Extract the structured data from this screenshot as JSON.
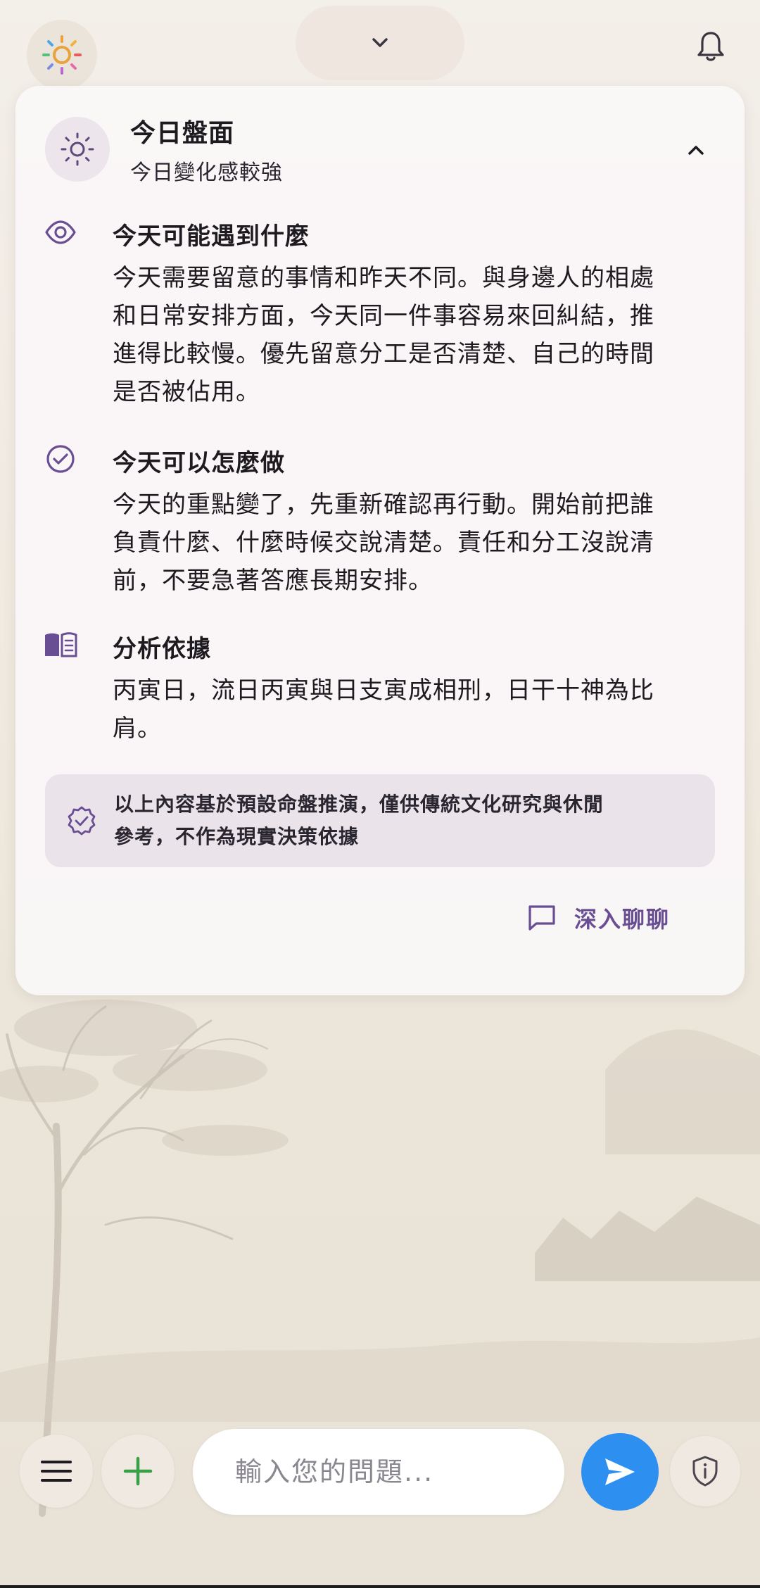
{
  "colors": {
    "accent": "#6a4e94",
    "send_button": "#2d8ff0",
    "card_bg": "#faf7f8"
  },
  "header": {
    "left_icon": "sun-icon",
    "center_icon": "chevron-down-icon",
    "right_icon": "bell-icon"
  },
  "card": {
    "icon": "sun-icon",
    "title": "今日盤面",
    "subtitle": "今日變化感較強",
    "collapse_icon": "chevron-up-icon",
    "sections": [
      {
        "icon": "eye-icon",
        "title": "今天可能遇到什麼",
        "lines": [
          "今天需要留意的事情和昨天不同。與身邊人的相處",
          "和日常安排方面，今天同一件事容易來回糾結，推",
          "進得比較慢。優先留意分工是否清楚、自己的時間",
          "是否被佔用。"
        ]
      },
      {
        "icon": "check-circle-icon",
        "title": "今天可以怎麼做",
        "lines": [
          "今天的重點變了，先重新確認再行動。開始前把誰",
          "負責什麼、什麼時候交說清楚。責任和分工沒說清",
          "前，不要急著答應長期安排。"
        ]
      },
      {
        "icon": "book-icon",
        "title": "分析依據",
        "lines": [
          "丙寅日，流日丙寅與日支寅成相刑，日干十神為比",
          "肩。"
        ]
      }
    ],
    "disclaimer": {
      "icon": "verified-badge-icon",
      "lines": [
        "以上內容基於預設命盤推演，僅供傳統文化研究與休閒",
        "參考，不作為現實決策依據"
      ]
    },
    "chat_link": {
      "icon": "chat-bubble-icon",
      "label": "深入聊聊"
    }
  },
  "bottom_bar": {
    "menu_icon": "menu-icon",
    "add_icon": "plus-icon",
    "input_placeholder": "輸入您的問題...",
    "send_icon": "send-icon",
    "privacy_icon": "shield-info-icon"
  }
}
